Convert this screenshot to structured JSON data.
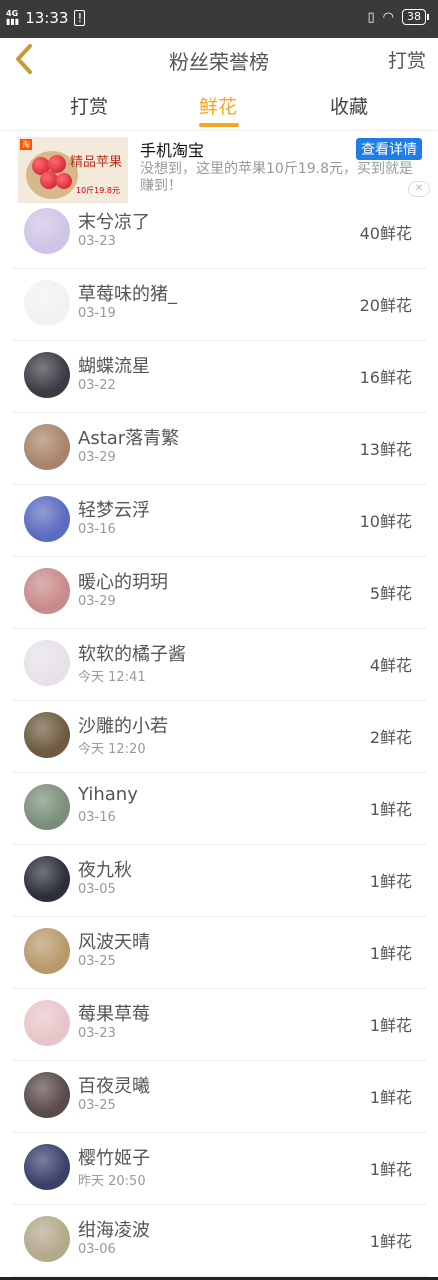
{
  "status_bar": {
    "time": "13:33",
    "network": "4G\nHD",
    "battery": "38"
  },
  "header": {
    "title": "粉丝荣誉榜",
    "right_action": "打赏"
  },
  "tabs": [
    {
      "label": "打赏",
      "active": false
    },
    {
      "label": "鲜花",
      "active": true
    },
    {
      "label": "收藏",
      "active": false
    }
  ],
  "colors": {
    "accent": "#f5a623",
    "ad_button": "#1e7de6"
  },
  "ad": {
    "title": "手机淘宝",
    "description": "没想到，这里的苹果10斤19.8元，买到就是赚到！",
    "button": "查看详情",
    "close": "✕",
    "image_text": "精品苹果",
    "image_price": "10斤19.8元",
    "image_tag": "淘"
  },
  "rows": [
    {
      "name": "末兮凉了",
      "date": "03-23",
      "count": "40鲜花",
      "avatar": "#cfc4e6"
    },
    {
      "name": "草莓味的猪_",
      "date": "03-19",
      "count": "20鲜花",
      "avatar": "#f2f2f2"
    },
    {
      "name": "蝴蝶流星",
      "date": "03-22",
      "count": "16鲜花",
      "avatar": "#3d3a44"
    },
    {
      "name": "Astar落青繁",
      "date": "03-29",
      "count": "13鲜花",
      "avatar": "#a8846a"
    },
    {
      "name": "轻梦云浮",
      "date": "03-16",
      "count": "10鲜花",
      "avatar": "#5b6bbf"
    },
    {
      "name": "暖心的玥玥",
      "date": "03-29",
      "count": "5鲜花",
      "avatar": "#c98a8a"
    },
    {
      "name": "软软的橘子酱",
      "date": "今天 12:41",
      "count": "4鲜花",
      "avatar": "#e6e2e8"
    },
    {
      "name": "沙雕的小若",
      "date": "今天 12:20",
      "count": "2鲜花",
      "avatar": "#6e5a40"
    },
    {
      "name": "Yihany",
      "date": "03-16",
      "count": "1鲜花",
      "avatar": "#7a8f7a"
    },
    {
      "name": "夜九秋",
      "date": "03-05",
      "count": "1鲜花",
      "avatar": "#2a2f3a"
    },
    {
      "name": "风波天晴",
      "date": "03-25",
      "count": "1鲜花",
      "avatar": "#b89a6a"
    },
    {
      "name": "莓果草莓",
      "date": "03-23",
      "count": "1鲜花",
      "avatar": "#e7c6c9"
    },
    {
      "name": "百夜灵曦",
      "date": "03-25",
      "count": "1鲜花",
      "avatar": "#5a4a4a"
    },
    {
      "name": "樱竹姬子",
      "date": "昨天 20:50",
      "count": "1鲜花",
      "avatar": "#3b3f6a"
    },
    {
      "name": "绀海凌波",
      "date": "03-06",
      "count": "1鲜花",
      "avatar": "#b5a98c"
    }
  ]
}
